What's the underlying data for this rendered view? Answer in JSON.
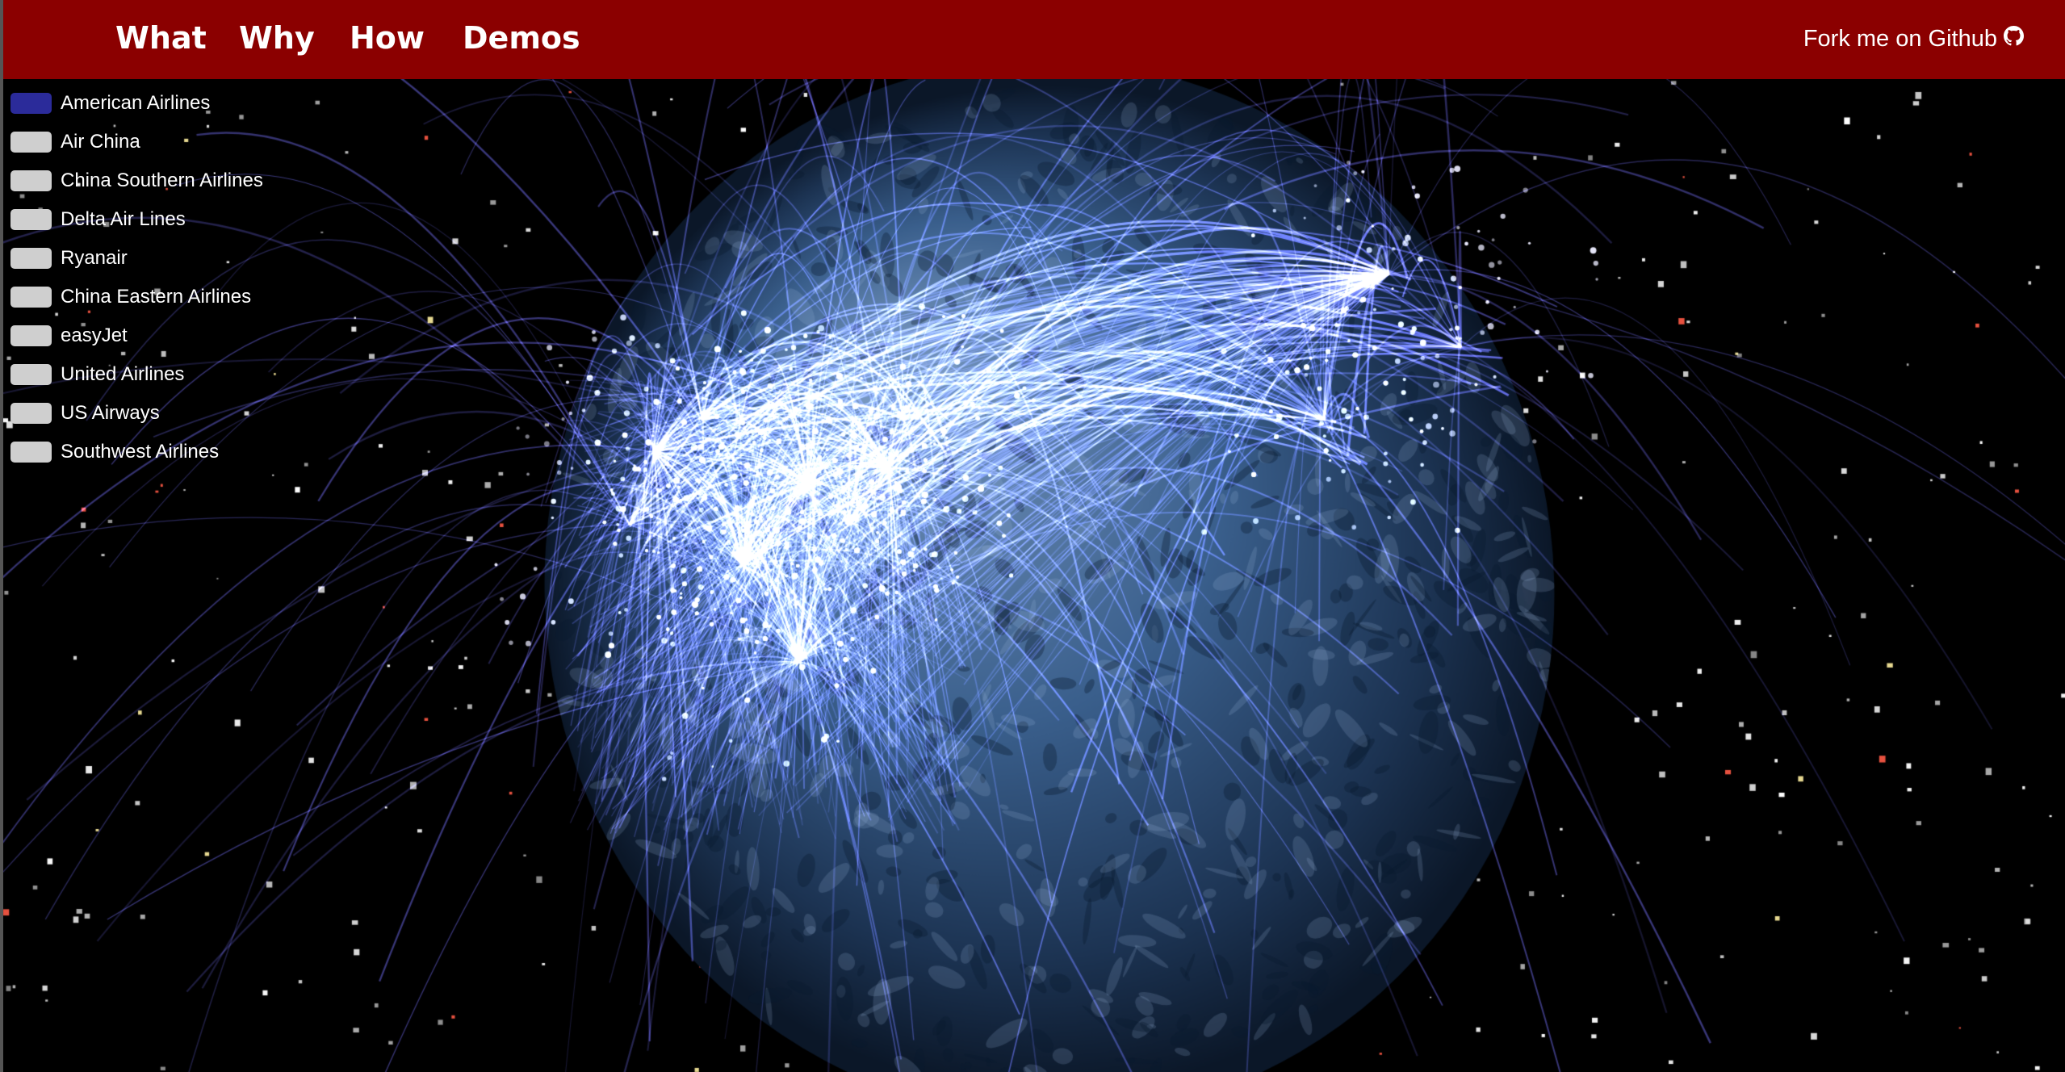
{
  "nav": {
    "items": [
      {
        "label": "What"
      },
      {
        "label": "Why"
      },
      {
        "label": "How"
      },
      {
        "label": "Demos"
      }
    ],
    "fork_label": "Fork me on Github",
    "fork_icon": "github-icon",
    "bar_color": "#8b0000"
  },
  "airlines": {
    "items": [
      {
        "label": "American Airlines",
        "active": true
      },
      {
        "label": "Air China",
        "active": false
      },
      {
        "label": "China Southern Airlines",
        "active": false
      },
      {
        "label": "Delta Air Lines",
        "active": false
      },
      {
        "label": "Ryanair",
        "active": false
      },
      {
        "label": "China Eastern Airlines",
        "active": false
      },
      {
        "label": "easyJet",
        "active": false
      },
      {
        "label": "United Airlines",
        "active": false
      },
      {
        "label": "US Airways",
        "active": false
      },
      {
        "label": "Southwest Airlines",
        "active": false
      }
    ],
    "active_color": "#2b2b9a",
    "inactive_color": "#cfcfcf"
  },
  "scene": {
    "route_color": "#6f6cff",
    "globe_color": "#3a5f8c",
    "background": "#000000"
  }
}
